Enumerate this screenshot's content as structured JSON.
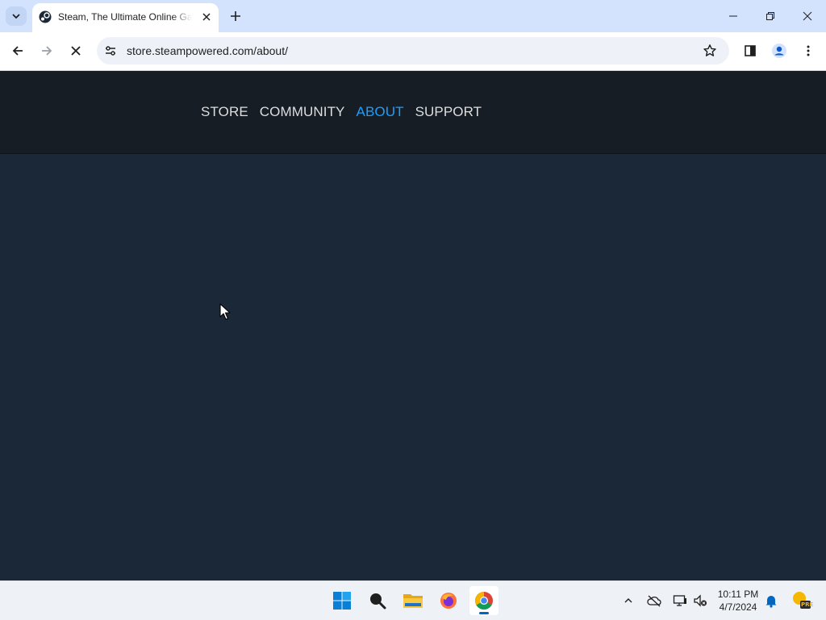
{
  "browser": {
    "tab": {
      "title": "Steam, The Ultimate Online Game Platform",
      "favicon": "steam-icon"
    },
    "url": "store.steampowered.com/about/",
    "colors": {
      "tabstrip": "#d3e3fd",
      "omnibox": "#eef2f8"
    }
  },
  "site": {
    "nav": [
      {
        "label": "STORE",
        "active": false
      },
      {
        "label": "COMMUNITY",
        "active": false
      },
      {
        "label": "ABOUT",
        "active": true
      },
      {
        "label": "SUPPORT",
        "active": false
      }
    ],
    "colors": {
      "header": "#171d25",
      "body": "#1b2838",
      "nav_text": "#dcdedf",
      "nav_active": "#1a9fff"
    }
  },
  "taskbar": {
    "apps": [
      "windows-start-icon",
      "search-icon",
      "file-explorer-icon",
      "firefox-icon",
      "chrome-icon"
    ],
    "active_app": "chrome-icon",
    "clock": {
      "time": "10:11 PM",
      "date": "4/7/2024"
    },
    "badge": "PRE"
  }
}
